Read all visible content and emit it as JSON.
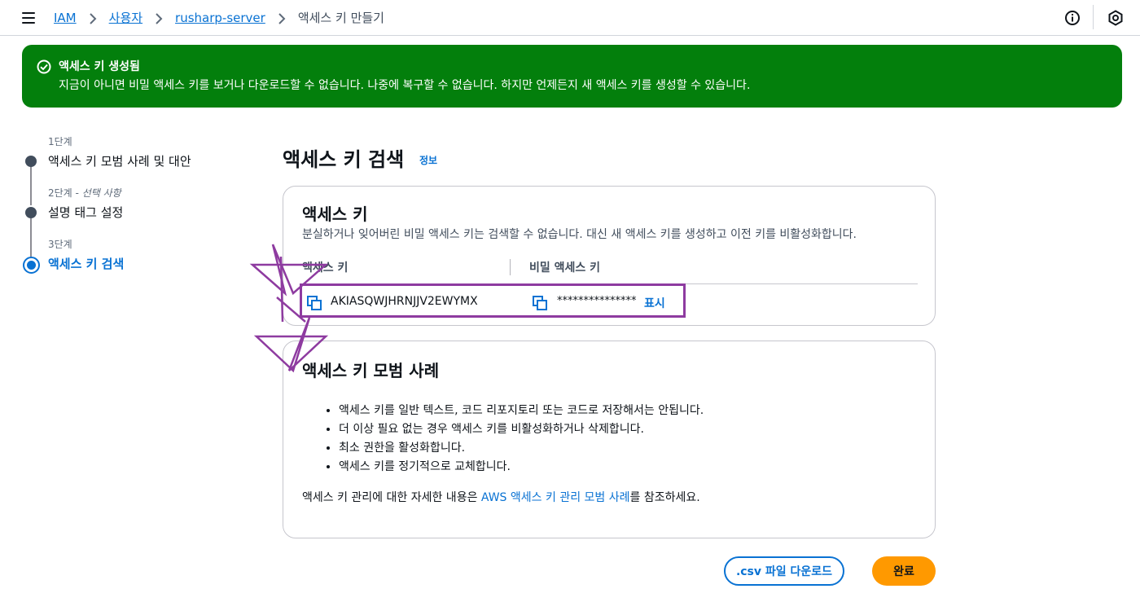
{
  "topbar": {
    "breadcrumb": [
      "IAM",
      "사용자",
      "rusharp-server"
    ],
    "breadcrumb_current": "액세스 키 만들기"
  },
  "flash": {
    "title": "액세스 키 생성됨",
    "message": "지금이 아니면 비밀 액세스 키를 보거나 다운로드할 수 없습니다. 나중에 복구할 수 없습니다. 하지만 언제든지 새 액세스 키를 생성할 수 있습니다.",
    "color": "#037f0c"
  },
  "steps": [
    {
      "number": "1단계",
      "optional": "",
      "label": "액세스 키 모범 사례 및 대안"
    },
    {
      "number": "2단계",
      "optional": "- 선택 사항",
      "label": "설명 태그 설정"
    },
    {
      "number": "3단계",
      "optional": "",
      "label": "액세스 키 검색"
    }
  ],
  "main": {
    "title": "액세스 키 검색",
    "info_link": "정보"
  },
  "access_key_card": {
    "title": "액세스 키",
    "description": "분실하거나 잊어버린 비밀 액세스 키는 검색할 수 없습니다. 대신 새 액세스 키를 생성하고 이전 키를 비활성화합니다.",
    "columns": [
      "액세스 키",
      "비밀 액세스 키"
    ],
    "access_key": "AKIASQWJHRNJJV2EWYMX",
    "secret_masked": "***************",
    "show_label": "표시"
  },
  "best_practices_card": {
    "title": "액세스 키 모범 사례",
    "items": [
      "액세스 키를 일반 텍스트, 코드 리포지토리 또는 코드로 저장해서는 안됩니다.",
      "더 이상 필요 없는 경우 액세스 키를 비활성화하거나 삭제합니다.",
      "최소 권한을 활성화합니다.",
      "액세스 키를 정기적으로 교체합니다."
    ],
    "ref_prefix": "액세스 키 관리에 대한 자세한 내용은 ",
    "ref_link": "AWS 액세스 키 관리 모범 사례",
    "ref_suffix": "를 참조하세요."
  },
  "buttons": {
    "download_csv": ".csv 파일 다운로드",
    "done": "완료"
  },
  "colors": {
    "accent": "#0972d3",
    "primary_button": "#ff9900",
    "annotation": "#8e3ba0"
  }
}
